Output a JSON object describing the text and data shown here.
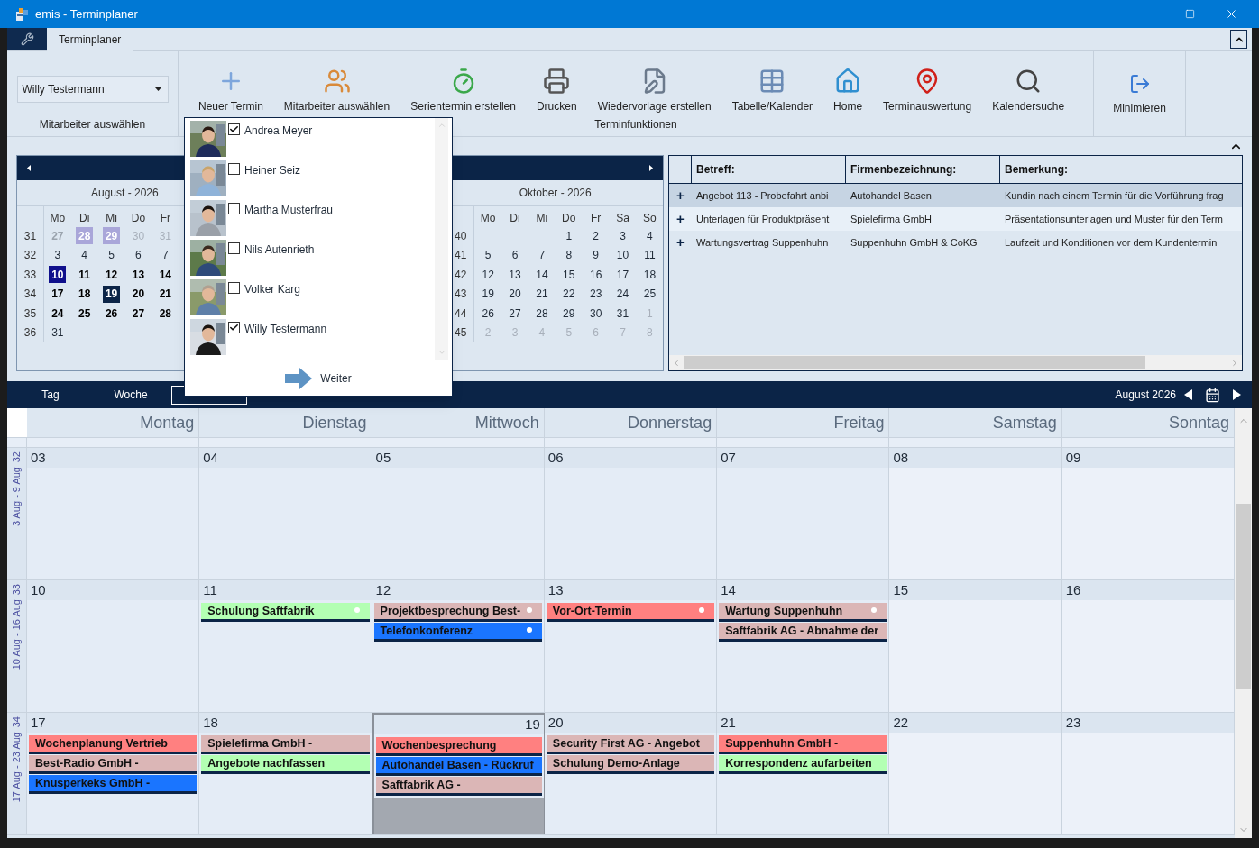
{
  "window": {
    "title": "emis - Terminplaner"
  },
  "ribbon_tabs": [
    {
      "label": "Terminplaner",
      "selected": true
    }
  ],
  "employee_group": {
    "value": "Willy Testermann",
    "label": "Mitarbeiter auswählen"
  },
  "function_group": {
    "label": "Terminfunktionen",
    "buttons": [
      "Neuer Termin",
      "Mitarbeiter auswählen",
      "Serientermin erstellen",
      "Drucken",
      "Wiedervorlage erstellen",
      "Tabelle/Kalender",
      "Home",
      "Terminauswertung",
      "Kalendersuche"
    ]
  },
  "minimize_group": {
    "buttons": [
      "Minimieren"
    ]
  },
  "mini_calendar": {
    "months": [
      {
        "title": "August - 2026",
        "weekdays": [
          "Mo",
          "Di",
          "Mi",
          "Do",
          "Fr"
        ],
        "weeks": [
          {
            "week": "31",
            "days": [
              {
                "text": "27",
                "kind": "faded-bold"
              },
              {
                "text": "28",
                "kind": "range"
              },
              {
                "text": "29",
                "kind": "range"
              },
              {
                "text": "30",
                "kind": "muted"
              },
              {
                "text": "31",
                "kind": "muted"
              }
            ]
          },
          {
            "week": "32",
            "days": [
              {
                "text": "3",
                "kind": "plain"
              },
              {
                "text": "4",
                "kind": "plain"
              },
              {
                "text": "5",
                "kind": "plain"
              },
              {
                "text": "6",
                "kind": "plain"
              },
              {
                "text": "7",
                "kind": "plain"
              }
            ]
          },
          {
            "week": "33",
            "days": [
              {
                "text": "10",
                "kind": "today"
              },
              {
                "text": "11",
                "kind": "bold"
              },
              {
                "text": "12",
                "kind": "bold"
              },
              {
                "text": "13",
                "kind": "bold"
              },
              {
                "text": "14",
                "kind": "bold"
              }
            ]
          },
          {
            "week": "34",
            "days": [
              {
                "text": "17",
                "kind": "bold"
              },
              {
                "text": "18",
                "kind": "bold"
              },
              {
                "text": "19",
                "kind": "selected"
              },
              {
                "text": "20",
                "kind": "bold"
              },
              {
                "text": "21",
                "kind": "bold"
              }
            ]
          },
          {
            "week": "35",
            "days": [
              {
                "text": "24",
                "kind": "bold"
              },
              {
                "text": "25",
                "kind": "bold"
              },
              {
                "text": "26",
                "kind": "bold"
              },
              {
                "text": "27",
                "kind": "bold"
              },
              {
                "text": "28",
                "kind": "bold"
              }
            ]
          },
          {
            "week": "36",
            "days": [
              {
                "text": "31",
                "kind": "plain"
              }
            ]
          }
        ]
      },
      {
        "title": "Oktober - 2026",
        "weekdays": [
          "Mo",
          "Di",
          "Mi",
          "Do",
          "Fr",
          "Sa",
          "So"
        ],
        "weeks": [
          {
            "week": "40",
            "days": [
              {
                "kind": "blank"
              },
              {
                "kind": "blank"
              },
              {
                "kind": "blank"
              },
              {
                "text": "1",
                "kind": "plain"
              },
              {
                "text": "2",
                "kind": "plain"
              },
              {
                "text": "3",
                "kind": "plain"
              },
              {
                "text": "4",
                "kind": "plain"
              }
            ]
          },
          {
            "week": "41",
            "days": [
              {
                "text": "5",
                "kind": "plain"
              },
              {
                "text": "6",
                "kind": "plain"
              },
              {
                "text": "7",
                "kind": "plain"
              },
              {
                "text": "8",
                "kind": "plain"
              },
              {
                "text": "9",
                "kind": "plain"
              },
              {
                "text": "10",
                "kind": "plain"
              },
              {
                "text": "11",
                "kind": "plain"
              }
            ]
          },
          {
            "week": "42",
            "days": [
              {
                "text": "12",
                "kind": "plain"
              },
              {
                "text": "13",
                "kind": "plain"
              },
              {
                "text": "14",
                "kind": "plain"
              },
              {
                "text": "15",
                "kind": "plain"
              },
              {
                "text": "16",
                "kind": "plain"
              },
              {
                "text": "17",
                "kind": "plain"
              },
              {
                "text": "18",
                "kind": "plain"
              }
            ]
          },
          {
            "week": "43",
            "days": [
              {
                "text": "19",
                "kind": "plain"
              },
              {
                "text": "20",
                "kind": "plain"
              },
              {
                "text": "21",
                "kind": "plain"
              },
              {
                "text": "22",
                "kind": "plain"
              },
              {
                "text": "23",
                "kind": "plain"
              },
              {
                "text": "24",
                "kind": "plain"
              },
              {
                "text": "25",
                "kind": "plain"
              }
            ]
          },
          {
            "week": "44",
            "days": [
              {
                "text": "26",
                "kind": "plain"
              },
              {
                "text": "27",
                "kind": "plain"
              },
              {
                "text": "28",
                "kind": "plain"
              },
              {
                "text": "29",
                "kind": "plain"
              },
              {
                "text": "30",
                "kind": "plain"
              },
              {
                "text": "31",
                "kind": "plain"
              },
              {
                "text": "1",
                "kind": "muted"
              }
            ]
          },
          {
            "week": "45",
            "days": [
              {
                "text": "2",
                "kind": "muted"
              },
              {
                "text": "3",
                "kind": "muted"
              },
              {
                "text": "4",
                "kind": "muted"
              },
              {
                "text": "5",
                "kind": "muted"
              },
              {
                "text": "6",
                "kind": "muted"
              },
              {
                "text": "7",
                "kind": "muted"
              },
              {
                "text": "8",
                "kind": "muted"
              }
            ]
          }
        ]
      }
    ]
  },
  "employee_popup": {
    "employees": [
      {
        "name": "Andrea Meyer",
        "checked": true
      },
      {
        "name": "Heiner Seiz",
        "checked": false
      },
      {
        "name": "Martha Musterfrau",
        "checked": false
      },
      {
        "name": "Nils Autenrieth",
        "checked": false
      },
      {
        "name": "Volker Karg",
        "checked": false
      },
      {
        "name": "Willy Testermann",
        "checked": true
      }
    ],
    "next_button": "Weiter"
  },
  "table": {
    "columns": [
      "Betreff:",
      "Firmenbezeichnung:",
      "Bemerkung:"
    ],
    "rows": [
      {
        "expander": "+",
        "selected": true,
        "cells": [
          "Angebot 113 - Probefahrt anbi",
          "Autohandel Basen",
          "Kundin nach einem Termin für die Vorführung frag"
        ]
      },
      {
        "expander": "+",
        "selected": false,
        "cells": [
          "Unterlagen für Produktpräsent",
          "Spielefirma GmbH",
          "Präsentationsunterlagen und Muster für den Term"
        ]
      },
      {
        "expander": "+",
        "selected": false,
        "cells": [
          "Wartungsvertrag Suppenhuhn",
          "Suppenhuhn GmbH & CoKG",
          "Laufzeit und Konditionen vor dem Kundentermin"
        ]
      }
    ]
  },
  "view_bar": {
    "views": [
      {
        "label": "Tag",
        "selected": false
      },
      {
        "label": "Woche",
        "selected": false
      },
      {
        "selected": true
      }
    ],
    "period": "August 2026"
  },
  "month": {
    "weekdays": [
      "Montag",
      "Dienstag",
      "Mittwoch",
      "Donnerstag",
      "Freitag",
      "Samstag",
      "Sonntag"
    ],
    "weeks": [
      {
        "number": "32",
        "range": "3 Aug - 9 Aug",
        "days": [
          {
            "date": "03",
            "selected": false
          },
          {
            "date": "04",
            "selected": false
          },
          {
            "date": "05",
            "selected": false
          },
          {
            "date": "06",
            "selected": false
          },
          {
            "date": "07",
            "selected": false
          },
          {
            "date": "08",
            "selected": false
          },
          {
            "date": "09",
            "selected": false
          }
        ]
      },
      {
        "number": "33",
        "range": "10 Aug - 16 Aug",
        "days": [
          {
            "date": "10",
            "selected": false
          },
          {
            "date": "11",
            "selected": false,
            "appointments": [
              {
                "title": "Schulung Saftfabrik",
                "color": "#b3ffb3",
                "reminder": true
              }
            ]
          },
          {
            "date": "12",
            "selected": false,
            "appointments": [
              {
                "title": "Projektbesprechung Best-",
                "color": "#dbb6b6",
                "reminder": true
              },
              {
                "title": "Telefonkonferenz",
                "color": "#1a75ff",
                "reminder": true
              }
            ]
          },
          {
            "date": "13",
            "selected": false,
            "appointments": [
              {
                "title": "Vor-Ort-Termin",
                "color": "#ff8080",
                "reminder": true
              }
            ]
          },
          {
            "date": "14",
            "selected": false,
            "appointments": [
              {
                "title": "Wartung Suppenhuhn",
                "color": "#dbb6b6",
                "reminder": true
              },
              {
                "title": "Saftfabrik AG - Abnahme der",
                "color": "#dbb6b6",
                "reminder": false
              }
            ]
          },
          {
            "date": "15",
            "selected": false
          },
          {
            "date": "16",
            "selected": false
          }
        ]
      },
      {
        "number": "34",
        "range": "17 Aug - 23 Aug",
        "days": [
          {
            "date": "17",
            "selected": false,
            "appointments": [
              {
                "title": "Wochenplanung Vertrieb",
                "color": "#ff8080",
                "reminder": false
              },
              {
                "title": "Best-Radio GmbH -",
                "color": "#dbb6b6",
                "reminder": false
              },
              {
                "title": "Knusperkeks GmbH -",
                "color": "#1a75ff",
                "reminder": false
              }
            ]
          },
          {
            "date": "18",
            "selected": false,
            "appointments": [
              {
                "title": "Spielefirma GmbH -",
                "color": "#dbb6b6",
                "reminder": false
              },
              {
                "title": "Angebote nachfassen",
                "color": "#b3ffb3",
                "reminder": false
              }
            ]
          },
          {
            "date": "19",
            "selected": true,
            "appointments": [
              {
                "title": "Wochenbesprechung",
                "color": "#ff8080",
                "reminder": false
              },
              {
                "title": "Autohandel Basen - Rückruf",
                "color": "#1a75ff",
                "reminder": false
              },
              {
                "title": "Saftfabrik AG -",
                "color": "#dbb6b6",
                "reminder": false
              }
            ]
          },
          {
            "date": "20",
            "selected": false,
            "appointments": [
              {
                "title": "Security First AG - Angebot",
                "color": "#dbb6b6",
                "reminder": false
              },
              {
                "title": "Schulung Demo-Anlage",
                "color": "#dbb6b6",
                "reminder": false
              }
            ]
          },
          {
            "date": "21",
            "selected": false,
            "appointments": [
              {
                "title": "Suppenhuhn GmbH -",
                "color": "#ff8080",
                "reminder": false
              },
              {
                "title": "Korrespondenz aufarbeiten",
                "color": "#b3ffb3",
                "reminder": false
              }
            ]
          },
          {
            "date": "22",
            "selected": false
          },
          {
            "date": "23",
            "selected": false
          }
        ]
      }
    ]
  }
}
